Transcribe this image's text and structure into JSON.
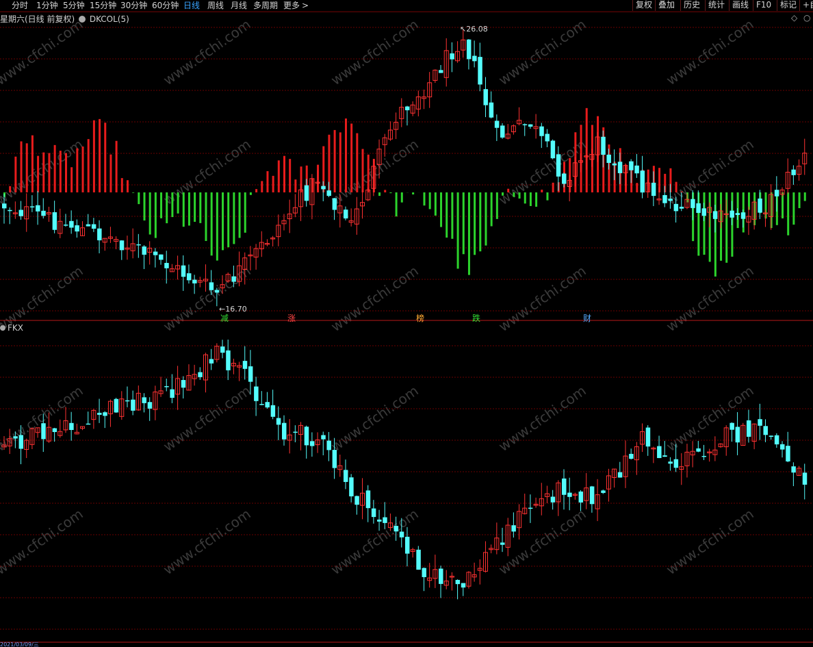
{
  "toolbar": {
    "periods": [
      "分时",
      "1分钟",
      "5分钟",
      "15分钟",
      "30分钟",
      "60分钟",
      "日线",
      "周线",
      "月线",
      "多周期",
      "更多"
    ],
    "active_period": "日线",
    "more_arrow": ">",
    "right_buttons": [
      "复权",
      "叠加",
      "历史",
      "统计",
      "画线",
      "F10",
      "标记",
      "+自"
    ]
  },
  "main_panel": {
    "title": "星期六(日线 前复权)",
    "indicator": "DKCOL(5)",
    "high_label": "26.08",
    "low_label": "16.70",
    "markers": [
      {
        "text": "减",
        "color": "#33dd33"
      },
      {
        "text": "涨",
        "color": "#ff4444"
      },
      {
        "text": "榜",
        "color": "#ffaa33"
      },
      {
        "text": "跌",
        "color": "#33dd33"
      },
      {
        "text": "财",
        "color": "#55aaff"
      }
    ]
  },
  "sub_panel": {
    "title": "FKX"
  },
  "bottom_axis": {
    "date": "2021/03/09/三"
  },
  "watermark": "www.cfchi.com",
  "colors": {
    "up": "#ff3232",
    "down": "#54fcfc",
    "hist_red": "#e81c1c",
    "hist_green": "#2cd42c",
    "grid": "#6a0000",
    "active": "#38a4ff"
  }
}
